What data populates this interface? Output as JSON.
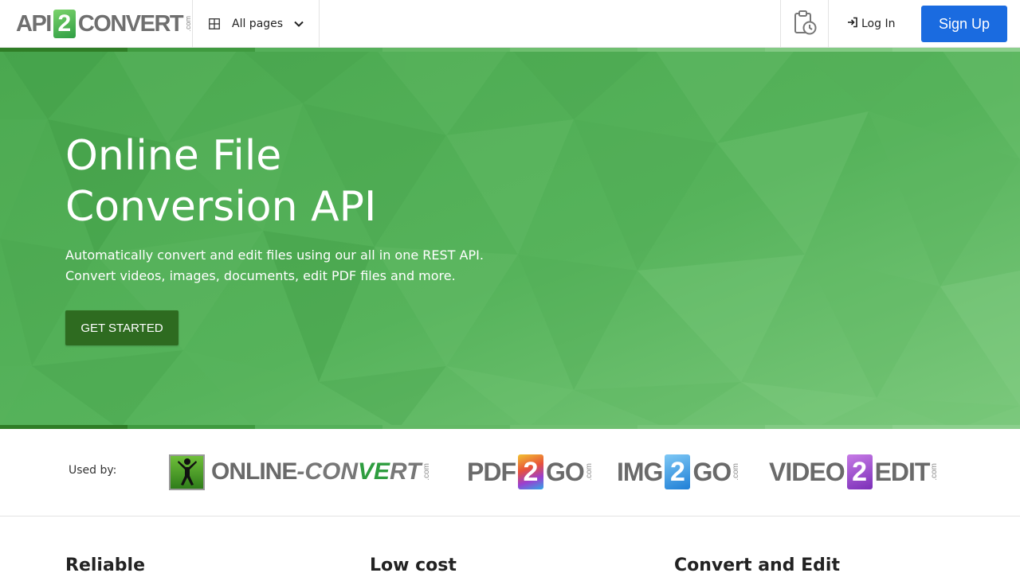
{
  "header": {
    "logo": {
      "left": "API",
      "middle": "2",
      "right": "CONVERT",
      "suffix": ".com"
    },
    "pages_menu_label": "All pages",
    "login_label": "Log In",
    "signup_label": "Sign Up"
  },
  "hero": {
    "title_line1": "Online File",
    "title_line2": "Conversion API",
    "subtitle_line1": "Automatically convert and edit files using our all in one REST API.",
    "subtitle_line2": "Convert videos, images, documents, edit PDF files and more.",
    "cta_label": "GET STARTED"
  },
  "used_by": {
    "label": "Used by:",
    "brands": {
      "online_convert": {
        "online": "ONLINE",
        "dash": "-",
        "convert": "CONVERT",
        "suffix": ".com"
      },
      "pdf2go": {
        "left": "PDF",
        "middle": "2",
        "right": "GO",
        "suffix": ".com"
      },
      "img2go": {
        "left": "IMG",
        "middle": "2",
        "right": "GO",
        "suffix": ".com"
      },
      "video2edit": {
        "left": "VIDEO",
        "middle": "2",
        "right": "EDIT",
        "suffix": ".com"
      }
    }
  },
  "features": [
    {
      "title": "Reliable"
    },
    {
      "title": "Low cost"
    },
    {
      "title": "Convert and Edit"
    }
  ],
  "colors": {
    "brand_green": "#55b25a",
    "cta_green": "#2e6b20",
    "signup_blue": "#1a6be0"
  },
  "icons": {
    "pages_menu": "grid-icon",
    "pages_chevron": "chevron-down-icon",
    "history": "clipboard-clock-icon",
    "login": "sign-in-icon"
  }
}
